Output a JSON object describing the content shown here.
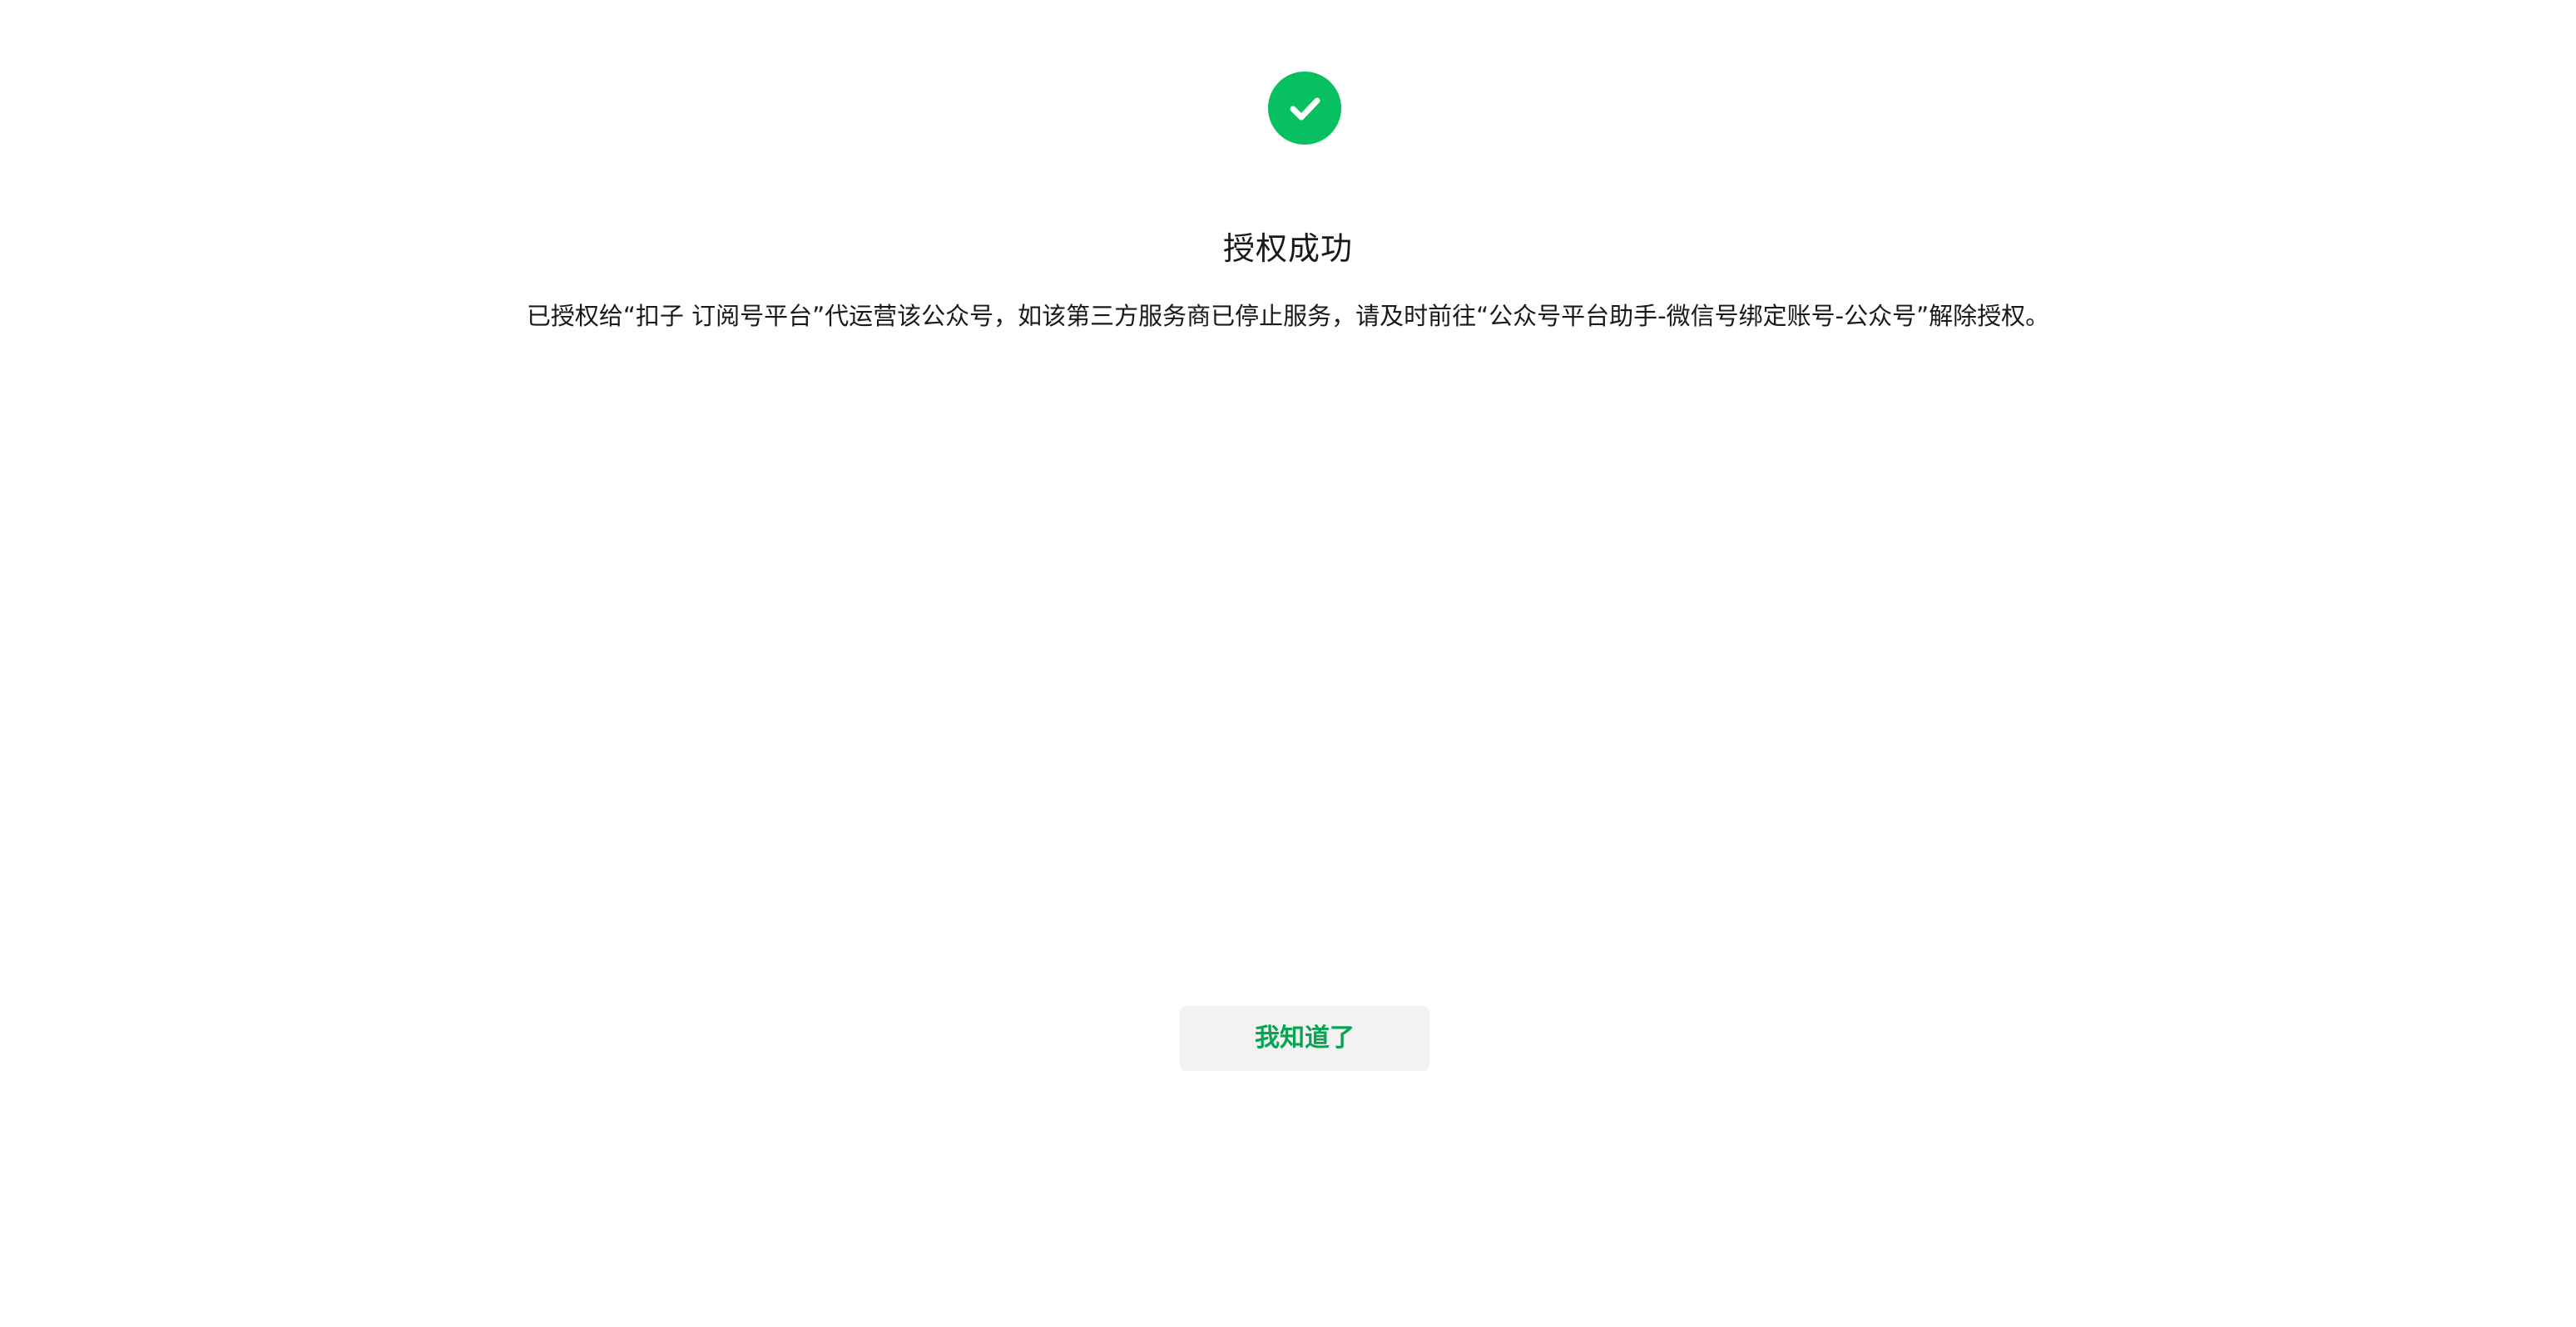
{
  "status": {
    "icon": "success-check-icon",
    "title": "授权成功",
    "message": "已授权给“扣子 订阅号平台”代运营该公众号，如该第三方服务商已停止服务，请及时前往“公众号平台助手-微信号绑定账号-公众号”解除授权。"
  },
  "actions": {
    "confirm_label": "我知道了"
  },
  "colors": {
    "success": "#07c160",
    "button_text": "#07a454",
    "button_background": "#f2f2f2"
  }
}
